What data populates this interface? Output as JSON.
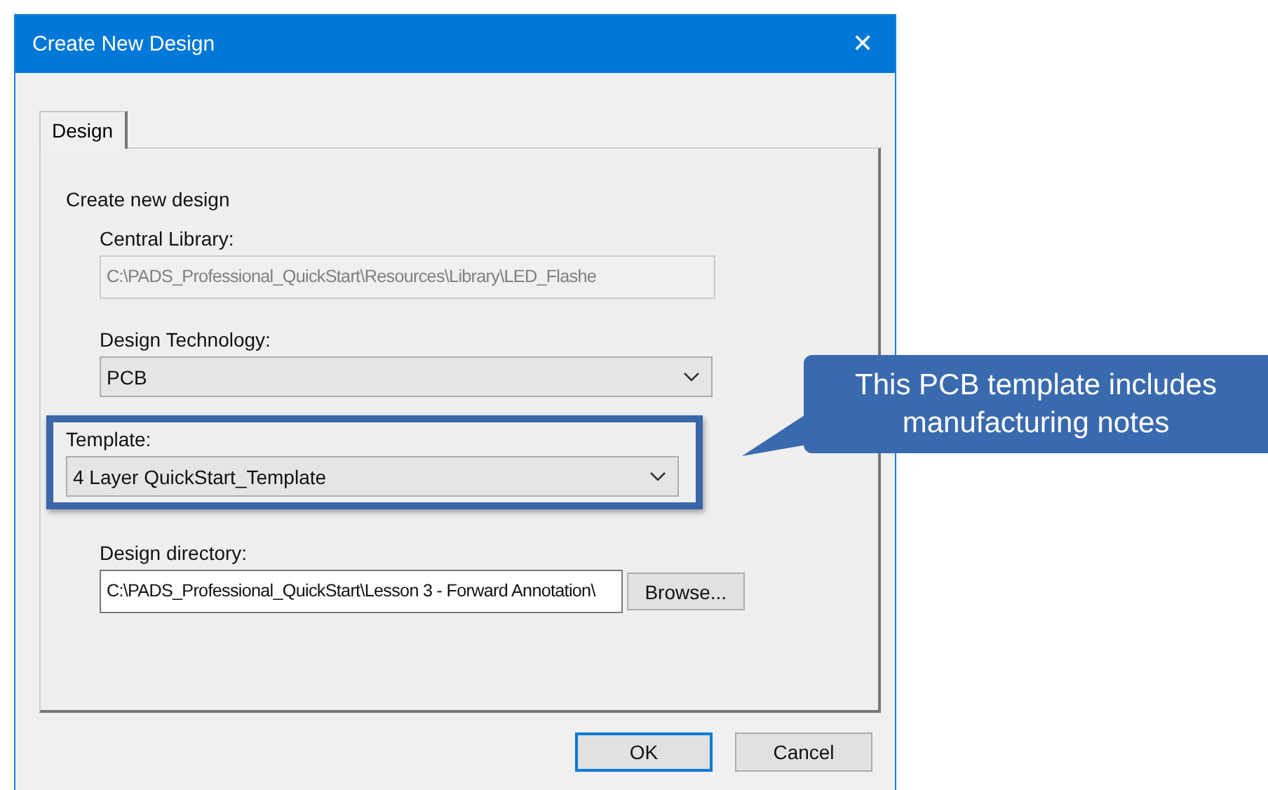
{
  "window": {
    "title": "Create New Design",
    "close": "✕"
  },
  "tabs": [
    {
      "label": "Design",
      "selected": true
    }
  ],
  "group_label": "Create new design",
  "fields": [
    {
      "label": "Central Library:",
      "kind": "text",
      "value": "C:\\PADS_Professional_QuickStart\\Resources\\Library\\LED_Flashe",
      "disabled": true,
      "highlighted": false
    },
    {
      "label": "Design Technology:",
      "kind": "dropdown",
      "value": "PCB",
      "disabled": false,
      "highlighted": false
    },
    {
      "label": "Template:",
      "kind": "dropdown",
      "value": "4 Layer QuickStart_Template",
      "disabled": false,
      "highlighted": true
    },
    {
      "label": "Design directory:",
      "kind": "text",
      "value": "C:\\PADS_Professional_QuickStart\\Lesson 3 - Forward Annotation\\",
      "disabled": false,
      "highlighted": false,
      "button": "Browse..."
    }
  ],
  "buttons": [
    {
      "label": "OK",
      "default": true
    },
    {
      "label": "Cancel",
      "default": false
    }
  ],
  "callout": {
    "text": "This PCB template includes manufacturing notes"
  }
}
